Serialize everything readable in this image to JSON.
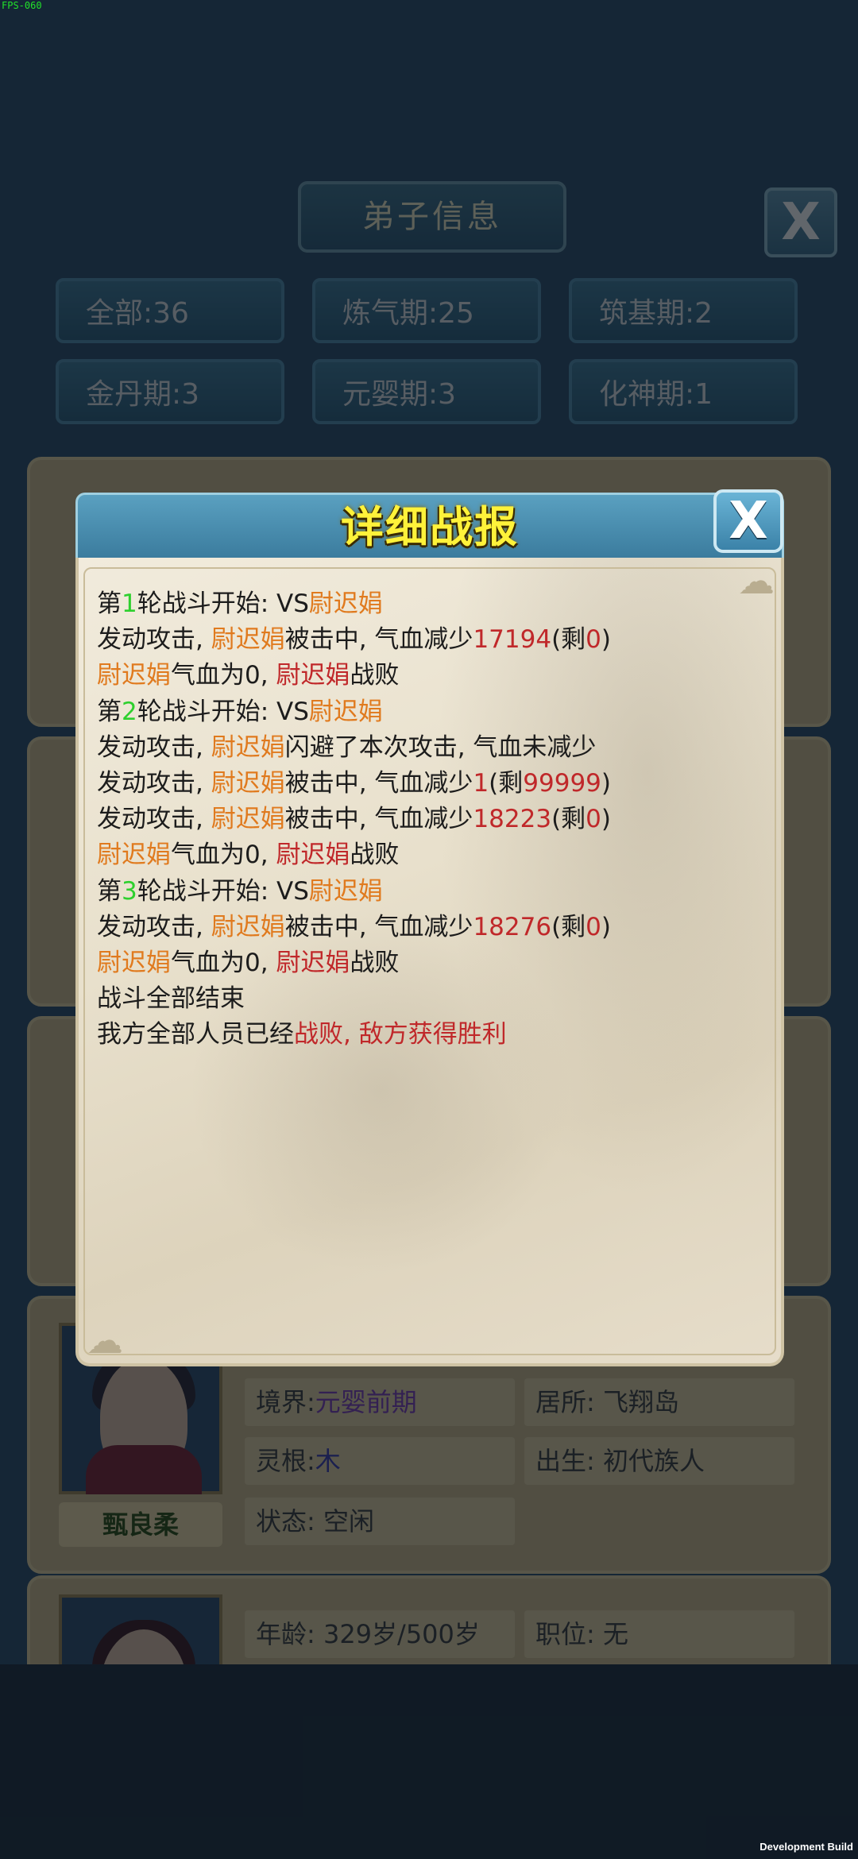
{
  "debug": {
    "fps": "FPS-060",
    "build": "Development Build"
  },
  "background": {
    "title": "弟子信息",
    "close": "X",
    "filters": [
      {
        "label": "全部:36"
      },
      {
        "label": "炼气期:25"
      },
      {
        "label": "筑基期:2"
      },
      {
        "label": "金丹期:3"
      },
      {
        "label": "元婴期:3"
      },
      {
        "label": "化神期:1"
      }
    ],
    "disciple": {
      "name": "甄良柔",
      "realm_label": "境界:",
      "realm_value": "元婴前期",
      "residence": "居所: 飞翔岛",
      "root_label": "灵根:",
      "root_value": "木",
      "birth": "出生: 初代族人",
      "status": "状态: 空闲"
    },
    "next_disciple": {
      "age": "年龄: 329岁/500岁",
      "position": "职位: 无"
    }
  },
  "modal": {
    "title": "详细战报",
    "close": "X",
    "lines": [
      [
        {
          "t": "第",
          "c": ""
        },
        {
          "t": "1",
          "c": "green"
        },
        {
          "t": "轮战斗开始: VS",
          "c": ""
        },
        {
          "t": "尉迟娟",
          "c": "orange"
        }
      ],
      [
        {
          "t": "发动攻击, ",
          "c": ""
        },
        {
          "t": "尉迟娟",
          "c": "orange"
        },
        {
          "t": "被击中, 气血减少",
          "c": ""
        },
        {
          "t": "17194",
          "c": "red"
        },
        {
          "t": "(剩",
          "c": ""
        },
        {
          "t": "0",
          "c": "red"
        },
        {
          "t": ")",
          "c": ""
        }
      ],
      [
        {
          "t": "尉迟娟",
          "c": "orange"
        },
        {
          "t": "气血为0, ",
          "c": ""
        },
        {
          "t": "尉迟娟",
          "c": "red"
        },
        {
          "t": "战败",
          "c": ""
        }
      ],
      [
        {
          "t": "第",
          "c": ""
        },
        {
          "t": "2",
          "c": "green"
        },
        {
          "t": "轮战斗开始: VS",
          "c": ""
        },
        {
          "t": "尉迟娟",
          "c": "orange"
        }
      ],
      [
        {
          "t": "发动攻击, ",
          "c": ""
        },
        {
          "t": "尉迟娟",
          "c": "orange"
        },
        {
          "t": "闪避了本次攻击, 气血未减少",
          "c": ""
        }
      ],
      [
        {
          "t": "发动攻击, ",
          "c": ""
        },
        {
          "t": "尉迟娟",
          "c": "orange"
        },
        {
          "t": "被击中, 气血减少",
          "c": ""
        },
        {
          "t": "1",
          "c": "red"
        },
        {
          "t": "(剩",
          "c": ""
        },
        {
          "t": "99999",
          "c": "red"
        },
        {
          "t": ")",
          "c": ""
        }
      ],
      [
        {
          "t": "发动攻击, ",
          "c": ""
        },
        {
          "t": "尉迟娟",
          "c": "orange"
        },
        {
          "t": "被击中, 气血减少",
          "c": ""
        },
        {
          "t": "18223",
          "c": "red"
        },
        {
          "t": "(剩",
          "c": ""
        },
        {
          "t": "0",
          "c": "red"
        },
        {
          "t": ")",
          "c": ""
        }
      ],
      [
        {
          "t": "尉迟娟",
          "c": "orange"
        },
        {
          "t": "气血为0, ",
          "c": ""
        },
        {
          "t": "尉迟娟",
          "c": "red"
        },
        {
          "t": "战败",
          "c": ""
        }
      ],
      [
        {
          "t": "第",
          "c": ""
        },
        {
          "t": "3",
          "c": "green"
        },
        {
          "t": "轮战斗开始: VS",
          "c": ""
        },
        {
          "t": "尉迟娟",
          "c": "orange"
        }
      ],
      [
        {
          "t": "发动攻击, ",
          "c": ""
        },
        {
          "t": "尉迟娟",
          "c": "orange"
        },
        {
          "t": "被击中, 气血减少",
          "c": ""
        },
        {
          "t": "18276",
          "c": "red"
        },
        {
          "t": "(剩",
          "c": ""
        },
        {
          "t": "0",
          "c": "red"
        },
        {
          "t": ")",
          "c": ""
        }
      ],
      [
        {
          "t": "尉迟娟",
          "c": "orange"
        },
        {
          "t": "气血为0, ",
          "c": ""
        },
        {
          "t": "尉迟娟",
          "c": "red"
        },
        {
          "t": "战败",
          "c": ""
        }
      ],
      [
        {
          "t": "战斗全部结束",
          "c": ""
        }
      ],
      [
        {
          "t": "我方全部人员已经",
          "c": ""
        },
        {
          "t": "战败, 敌方获得胜利",
          "c": "red"
        }
      ]
    ]
  },
  "colors": {
    "orange": "#e07a1e",
    "red": "#c0282a",
    "green": "#2ed02e",
    "title": "#fff23a"
  }
}
